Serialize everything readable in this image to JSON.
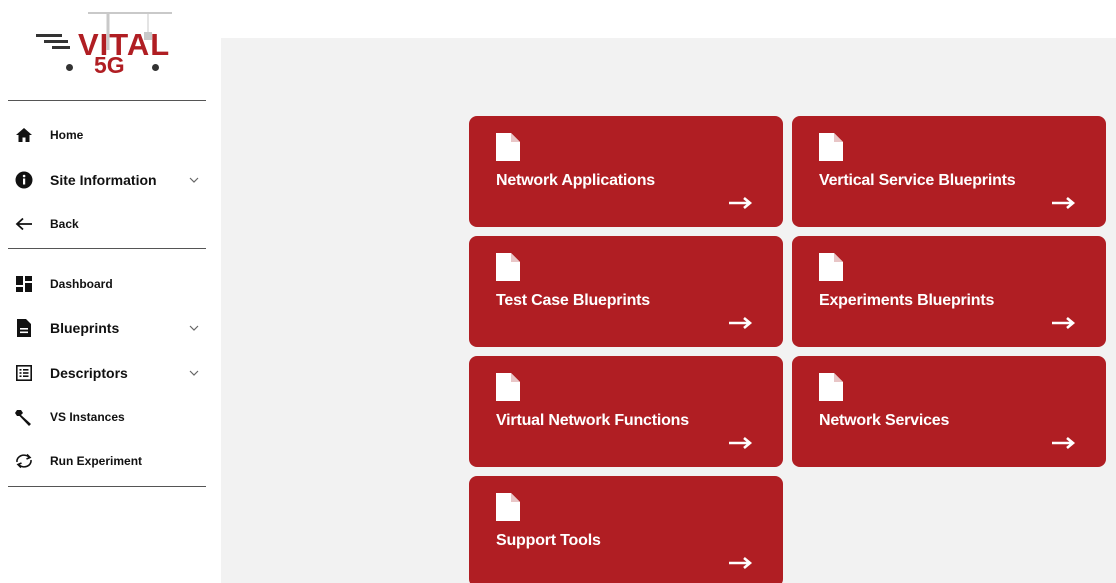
{
  "logo": {
    "word": "VITAL",
    "sub": "5G"
  },
  "sidebar": {
    "items": [
      {
        "label": "Home",
        "icon": "home-icon"
      },
      {
        "label": "Site Information",
        "icon": "info-icon",
        "expandable": true
      },
      {
        "label": "Back",
        "icon": "arrow-left-icon"
      },
      {
        "label": "Dashboard",
        "icon": "dashboard-icon"
      },
      {
        "label": "Blueprints",
        "icon": "document-icon",
        "expandable": true
      },
      {
        "label": "Descriptors",
        "icon": "list-icon",
        "expandable": true
      },
      {
        "label": "VS Instances",
        "icon": "wrench-icon"
      },
      {
        "label": "Run Experiment",
        "icon": "sync-icon"
      }
    ]
  },
  "cards": [
    {
      "title": "Network Applications"
    },
    {
      "title": "Vertical Service Blueprints"
    },
    {
      "title": "Test Case Blueprints"
    },
    {
      "title": "Experiments Blueprints"
    },
    {
      "title": "Virtual Network Functions"
    },
    {
      "title": "Network Services"
    },
    {
      "title": "Support Tools"
    }
  ],
  "colors": {
    "accent": "#b01e23",
    "background": "#f2f2f2"
  }
}
